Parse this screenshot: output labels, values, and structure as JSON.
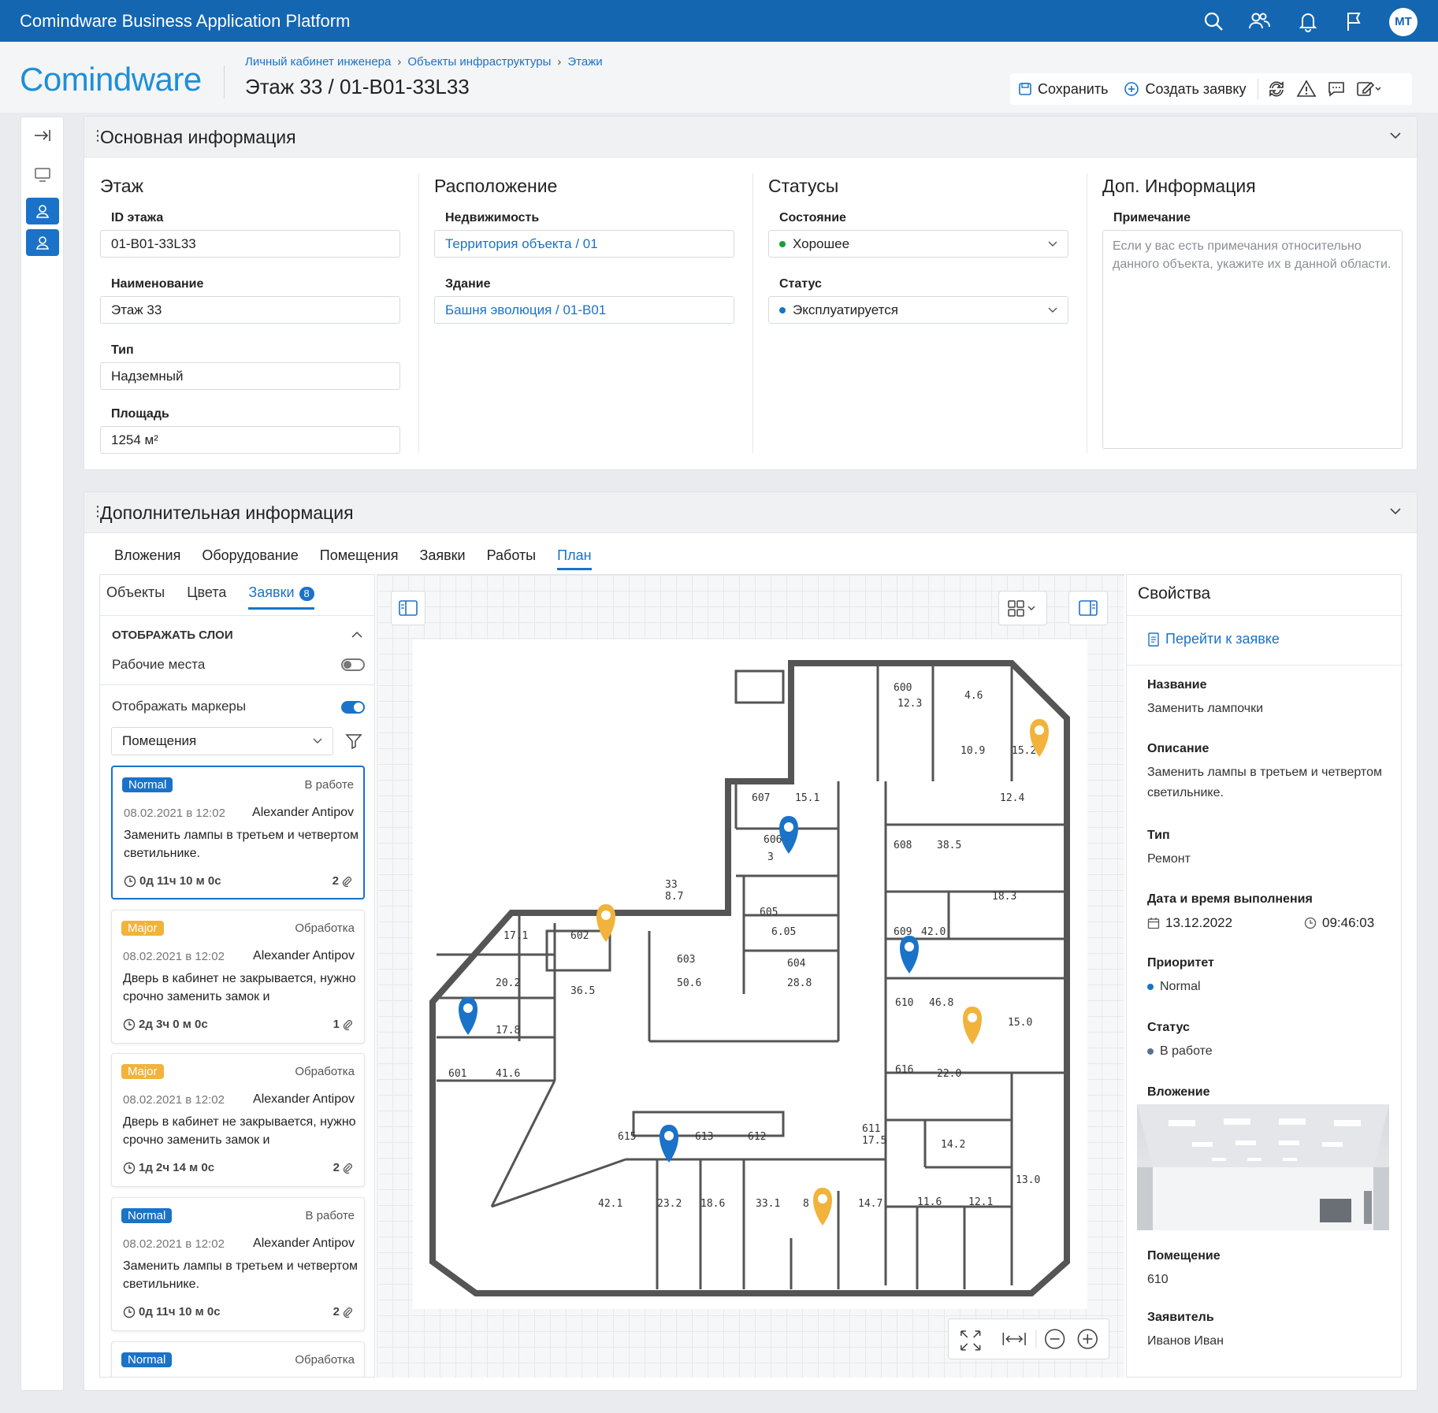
{
  "app": {
    "title": "Comindware Business Application Platform",
    "user_initials": "МТ"
  },
  "header": {
    "logo": "Comindware",
    "breadcrumb": [
      "Личный кабинет инженера",
      "Объекты инфраструктуры",
      "Этажи"
    ],
    "title": "Этаж 33 / 01-B01-33L33",
    "save_label": "Сохранить",
    "create_label": "Создать заявку"
  },
  "main_section": {
    "title": "Основная информация",
    "floor": {
      "title": "Этаж",
      "id_label": "ID этажа",
      "id_value": "01-B01-33L33",
      "name_label": "Наименование",
      "name_value": "Этаж 33",
      "type_label": "Тип",
      "type_value": "Надземный",
      "area_label": "Площадь",
      "area_value": "1254 м²"
    },
    "location": {
      "title": "Расположение",
      "property_label": "Недвижимость",
      "property_value": "Территория объекта / 01",
      "building_label": "Здание",
      "building_value": "Башня эволюция / 01-B01"
    },
    "statuses": {
      "title": "Статусы",
      "state_label": "Состояние",
      "state_value": "Хорошее",
      "status_label": "Статус",
      "status_value": "Эксплуатируется"
    },
    "extra": {
      "title": "Доп. Информация",
      "note_label": "Примечание",
      "note_placeholder": "Если у вас есть примечания относительно данного объекта, укажите их в данной области."
    }
  },
  "extra_section": {
    "title": "Дополнительная информация",
    "tabs": [
      "Вложения",
      "Оборудование",
      "Помещения",
      "Заявки",
      "Работы",
      "План"
    ],
    "active_tab": "План"
  },
  "left_panel": {
    "subtabs": [
      "Объекты",
      "Цвета",
      "Заявки"
    ],
    "requests_count": "8",
    "layers_title": "ОТОБРАЖАТЬ СЛОИ",
    "workplaces_label": "Рабочие места",
    "markers_label": "Отображать маркеры",
    "marker_filter": "Помещения",
    "cards": [
      {
        "priority": "Normal",
        "status": "В работе",
        "date": "08.02.2021 в 12:02",
        "author": "Alexander Antipov",
        "desc": "Заменить лампы в третьем и четвертом светильнике.",
        "timer": "0д 11ч 10 м 0с",
        "attachments": "2"
      },
      {
        "priority": "Major",
        "status": "Обработка",
        "date": "08.02.2021 в 12:02",
        "author": "Alexander Antipov",
        "desc": "Дверь в кабинет не закрывается, нужно срочно заменить замок и",
        "timer": "2д 3ч 0 м 0с",
        "attachments": "1"
      },
      {
        "priority": "Major",
        "status": "Обработка",
        "date": "08.02.2021 в 12:02",
        "author": "Alexander Antipov",
        "desc": "Дверь в кабинет не закрывается, нужно срочно заменить замок и",
        "timer": "1д 2ч 14 м 0с",
        "attachments": "2"
      },
      {
        "priority": "Normal",
        "status": "В работе",
        "date": "08.02.2021 в 12:02",
        "author": "Alexander Antipov",
        "desc": "Заменить лампы в третьем и четвертом светильнике.",
        "timer": "0д 11ч 10 м 0с",
        "attachments": "2"
      },
      {
        "priority": "Normal",
        "status": "Обработка"
      }
    ]
  },
  "plan": {
    "rooms": [
      {
        "num": "600",
        "area": "12.3"
      },
      {
        "num": "",
        "area": "4.6"
      },
      {
        "num": "",
        "area": "10.9"
      },
      {
        "num": "",
        "area": "15.2"
      },
      {
        "num": "607",
        "area": "15.1"
      },
      {
        "num": "",
        "area": "12.4"
      },
      {
        "num": "606",
        "area": "3"
      },
      {
        "num": "608",
        "area": "38.5"
      },
      {
        "num": "33",
        "area": "8.7"
      },
      {
        "num": "",
        "area": "18.3"
      },
      {
        "num": "",
        "area": "17.1"
      },
      {
        "num": "602",
        "area": "36.5"
      },
      {
        "num": "605",
        "area": "6.05"
      },
      {
        "num": "609",
        "area": "42.0"
      },
      {
        "num": "603",
        "area": "50.6"
      },
      {
        "num": "604",
        "area": "28.8"
      },
      {
        "num": "",
        "area": "20.2"
      },
      {
        "num": "",
        "area": "17.8"
      },
      {
        "num": "610",
        "area": "46.8"
      },
      {
        "num": "",
        "area": "15.0"
      },
      {
        "num": "601",
        "area": "41.6"
      },
      {
        "num": "616",
        "area": "22.0"
      },
      {
        "num": "",
        "area": "14.2"
      },
      {
        "num": "615",
        "area": "42.1"
      },
      {
        "num": "",
        "area": "23.2"
      },
      {
        "num": "613",
        "area": "18.6"
      },
      {
        "num": "612",
        "area": "33.1"
      },
      {
        "num": "",
        "area": "8"
      },
      {
        "num": "611",
        "area": "17.5"
      },
      {
        "num": "",
        "area": "14.7"
      },
      {
        "num": "",
        "area": "11.6"
      },
      {
        "num": "",
        "area": "12.1"
      },
      {
        "num": "",
        "area": "13.0"
      }
    ]
  },
  "properties": {
    "title": "Свойства",
    "goto_label": "Перейти к заявке",
    "name_label": "Название",
    "name_value": "Заменить лампочки",
    "desc_label": "Описание",
    "desc_value": "Заменить лампы в третьем и четвертом светильнике.",
    "type_label": "Тип",
    "type_value": "Ремонт",
    "datetime_label": "Дата и время выполнения",
    "date_value": "13.12.2022",
    "time_value": "09:46:03",
    "priority_label": "Приоритет",
    "priority_value": "Normal",
    "status_label": "Статус",
    "status_value": "В работе",
    "attachment_label": "Вложение",
    "room_label": "Помещение",
    "room_value": "610",
    "requester_label": "Заявитель",
    "requester_value": "Иванов Иван"
  },
  "colors": {
    "accent": "#1466b0",
    "link": "#1a73c8",
    "major": "#f1b33b",
    "good": "#1a9e3c"
  }
}
